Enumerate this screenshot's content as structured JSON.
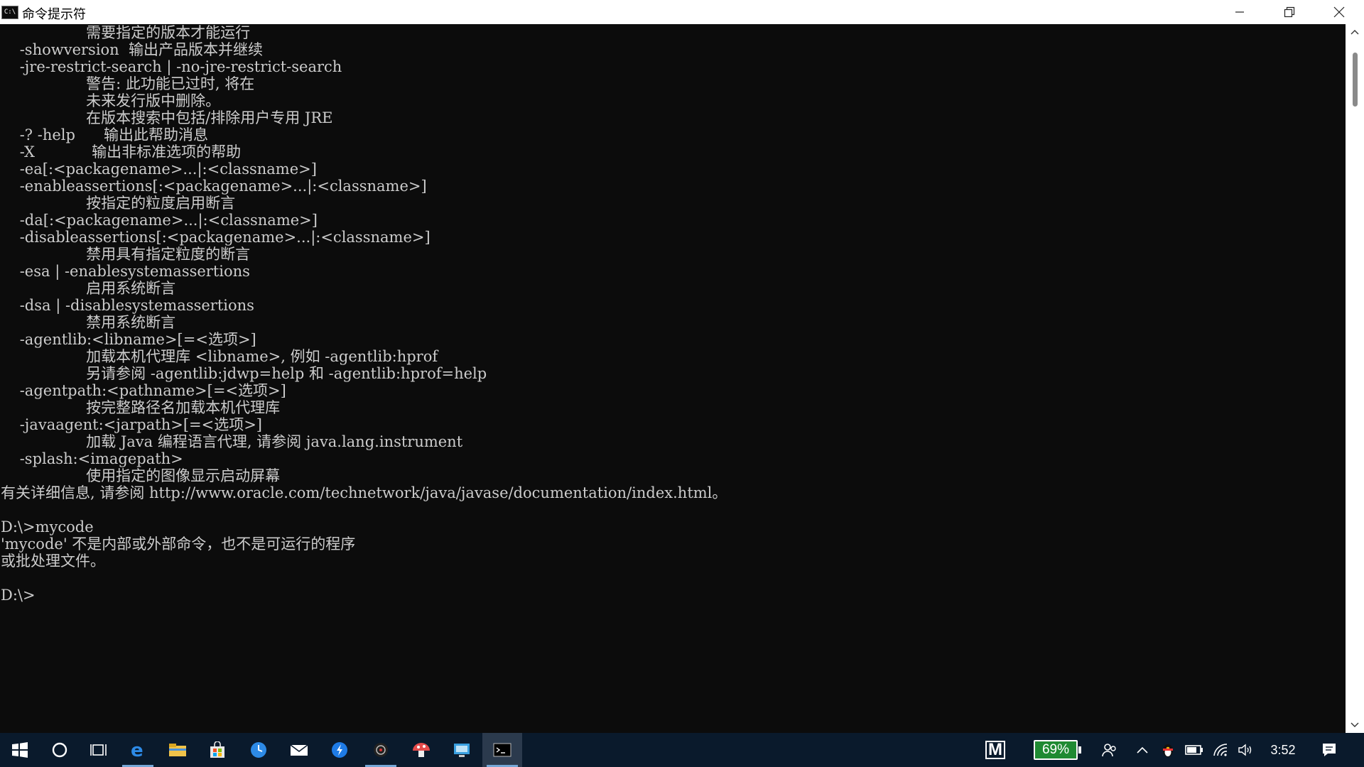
{
  "window": {
    "title": "命令提示符",
    "app_icon_text": "C:\\",
    "icons": {
      "minimize": "minimize-icon",
      "restore": "restore-icon",
      "close": "close-icon"
    }
  },
  "console": {
    "lines": [
      "                  需要指定的版本才能运行",
      "    -showversion  输出产品版本并继续",
      "    -jre-restrict-search | -no-jre-restrict-search",
      "                  警告: 此功能已过时, 将在",
      "                  未来发行版中删除。",
      "                  在版本搜索中包括/排除用户专用 JRE",
      "    -? -help      输出此帮助消息",
      "    -X            输出非标准选项的帮助",
      "    -ea[:<packagename>...|:<classname>]",
      "    -enableassertions[:<packagename>...|:<classname>]",
      "                  按指定的粒度启用断言",
      "    -da[:<packagename>...|:<classname>]",
      "    -disableassertions[:<packagename>...|:<classname>]",
      "                  禁用具有指定粒度的断言",
      "    -esa | -enablesystemassertions",
      "                  启用系统断言",
      "    -dsa | -disablesystemassertions",
      "                  禁用系统断言",
      "    -agentlib:<libname>[=<选项>]",
      "                  加载本机代理库 <libname>, 例如 -agentlib:hprof",
      "                  另请参阅 -agentlib:jdwp=help 和 -agentlib:hprof=help",
      "    -agentpath:<pathname>[=<选项>]",
      "                  按完整路径名加载本机代理库",
      "    -javaagent:<jarpath>[=<选项>]",
      "                  加载 Java 编程语言代理, 请参阅 java.lang.instrument",
      "    -splash:<imagepath>",
      "                  使用指定的图像显示启动屏幕",
      "有关详细信息, 请参阅 http://www.oracle.com/technetwork/java/javase/documentation/index.html。",
      "",
      "D:\\>mycode",
      "'mycode' 不是内部或外部命令，也不是可运行的程序",
      "或批处理文件。",
      "",
      "D:\\>"
    ]
  },
  "scrollbar": {
    "up_icon": "scroll-up-arrow-icon",
    "down_icon": "scroll-down-arrow-icon",
    "position": 0.03
  },
  "taskbar": {
    "apps": [
      "windows-start-icon",
      "cortana-search-icon",
      "task-view-icon",
      "edge-browser-icon",
      "file-explorer-icon",
      "store-icon",
      "clock-app-icon",
      "mail-icon",
      "blue-app-icon",
      "dark-app-icon",
      "mushroom-app-icon",
      "remote-desktop-icon",
      "command-prompt-icon"
    ],
    "tray": {
      "m_label": "M",
      "battery_percent": "69%",
      "time": "3:52"
    }
  }
}
